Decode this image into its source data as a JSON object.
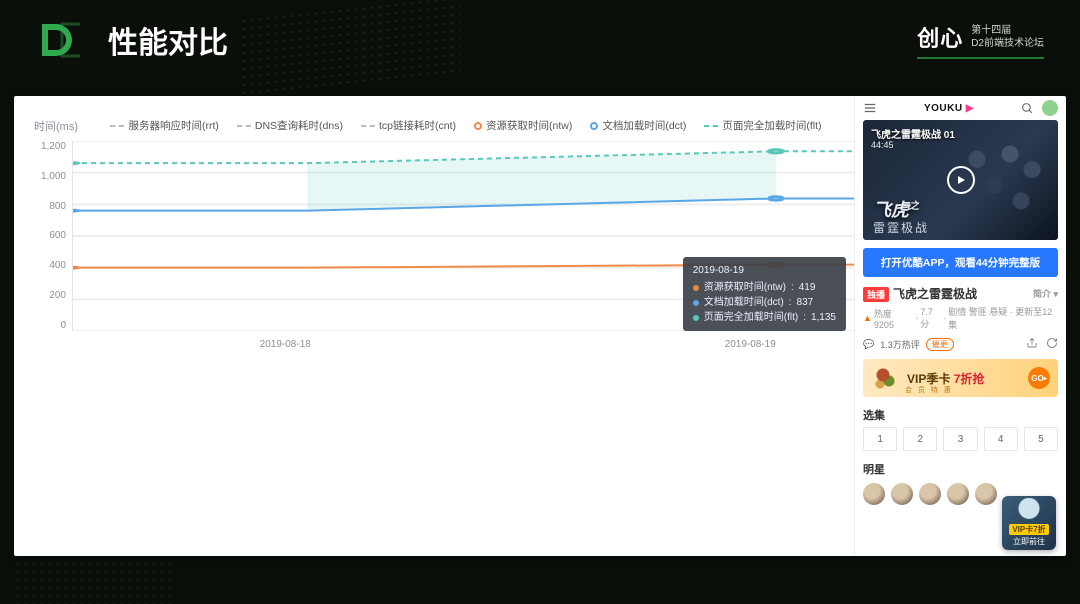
{
  "header": {
    "title": "性能对比",
    "brand": "创心",
    "sub1": "第十四届",
    "sub2": "D2前端技术论坛"
  },
  "legend": {
    "rrt": "服务器响应时间(rrt)",
    "dns": "DNS查询耗时(dns)",
    "cnt": "tcp链接耗时(cnt)",
    "ntw": "资源获取时间(ntw)",
    "dct": "文档加载时间(dct)",
    "flt": "页面完全加载时间(flt)"
  },
  "axis": {
    "ytitle": "时间(ms)",
    "yticks": [
      "1,200",
      "1,000",
      "800",
      "600",
      "400",
      "200",
      "0"
    ],
    "xticks": [
      "2019-08-18",
      "2019-08-19"
    ]
  },
  "tooltip": {
    "date": "2019-08-19",
    "rows": [
      {
        "color": "#f08a4b",
        "label": "资源获取时间(ntw)",
        "value": "419"
      },
      {
        "color": "#5aa7e6",
        "label": "文档加载时间(dct)",
        "value": "837"
      },
      {
        "color": "#58c9b9",
        "label": "页面完全加载时间(flt)",
        "value": "1,135"
      }
    ]
  },
  "colors": {
    "rrt": "#b8bec8",
    "dns": "#b8bec8",
    "cnt": "#b8bec8",
    "ntw": "#f08a4b",
    "dct": "#5aa7e6",
    "flt": "#58c9b9"
  },
  "app": {
    "logo": "YOUKU",
    "hero_title": "飞虎之雷霆极战 01",
    "hero_duration": "44:45",
    "hero_big": "飞虎",
    "hero_sub": "雷霆极战",
    "cta": "打开优酷APP，观看44分钟完整版",
    "tag_live": "独播",
    "video_title": "飞虎之雷霆极战",
    "drop_label": "简介",
    "heat": "热度 9205",
    "score": "7.7分",
    "genres": "剧情 警匪 悬疑 · 更新至12集",
    "like_count": "1.3万热评",
    "pill": "催更",
    "promo_main": "VIP季卡",
    "promo_accent": "7折抢",
    "promo_sub": "会 员 特 惠",
    "promo_go": "GO",
    "sec_episodes": "选集",
    "episodes": [
      "1",
      "2",
      "3",
      "4",
      "5"
    ],
    "sec_cast": "明星",
    "float_tag": "VIP卡7折",
    "float_sub": "立即前往"
  },
  "chart_data": {
    "type": "line",
    "title": "",
    "xlabel": "",
    "ylabel": "时间(ms)",
    "categories": [
      "2019-08-18",
      "2019-08-19"
    ],
    "ylim": [
      0,
      1200
    ],
    "series": [
      {
        "name": "服务器响应时间(rrt)",
        "key": "rrt",
        "style": "dashed",
        "color": "#b8bec8",
        "values": [
          null,
          null
        ]
      },
      {
        "name": "DNS查询耗时(dns)",
        "key": "dns",
        "style": "dashed",
        "color": "#b8bec8",
        "values": [
          null,
          null
        ]
      },
      {
        "name": "tcp链接耗时(cnt)",
        "key": "cnt",
        "style": "dashed",
        "color": "#b8bec8",
        "values": [
          null,
          null
        ]
      },
      {
        "name": "资源获取时间(ntw)",
        "key": "ntw",
        "style": "solid",
        "color": "#f08a4b",
        "values": [
          400,
          419
        ]
      },
      {
        "name": "文档加载时间(dct)",
        "key": "dct",
        "style": "solid",
        "color": "#5aa7e6",
        "values": [
          760,
          837
        ]
      },
      {
        "name": "页面完全加载时间(flt)",
        "key": "flt",
        "style": "dashed",
        "color": "#58c9b9",
        "values": [
          1060,
          1135
        ]
      }
    ],
    "tooltip_point": "2019-08-19"
  }
}
